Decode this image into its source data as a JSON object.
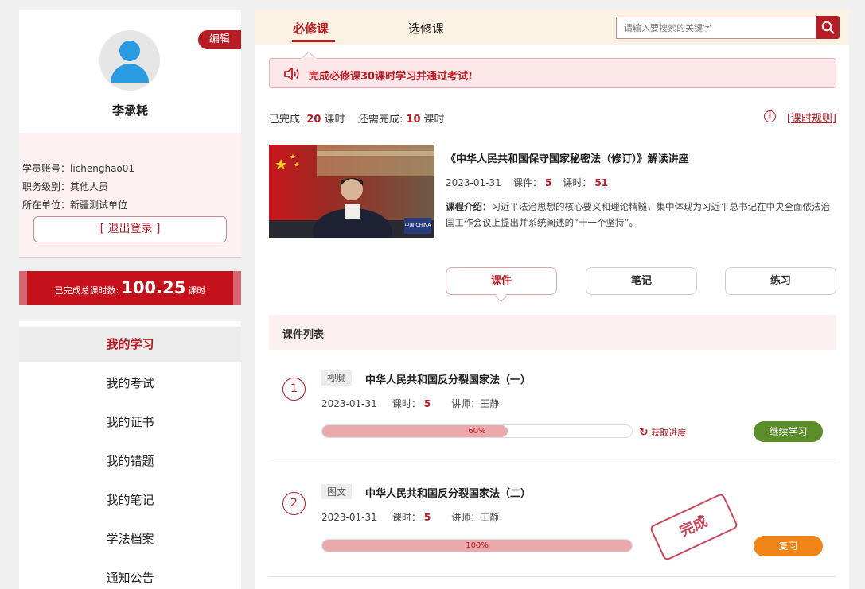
{
  "profile": {
    "edit_label": "编辑",
    "name": "李承耗",
    "account_line": "学员账号：lichenghao01",
    "level_line": "职务级别：其他人员",
    "unit_line": "所在单位：新疆测试单位",
    "logout_label": "[ 退出登录 ]"
  },
  "hours_banner": {
    "prefix": "已完成总课时数:",
    "value": "100.25",
    "suffix": "课时"
  },
  "nav": {
    "items": [
      "我的学习",
      "我的考试",
      "我的证书",
      "我的错题",
      "我的笔记",
      "学法档案",
      "通知公告"
    ],
    "active_index": 0
  },
  "tabs": {
    "required": "必修课",
    "elective": "选修课"
  },
  "search": {
    "placeholder": "请输入要搜索的关键字"
  },
  "notice": {
    "text": "完成必修课30课时学习并通过考试!"
  },
  "progress": {
    "completed_label": "已完成:",
    "completed_value": "20",
    "completed_unit": "课时",
    "remaining_label": "还需完成:",
    "remaining_value": "10",
    "remaining_unit": "课时",
    "rules_link": "[课时规则]"
  },
  "course": {
    "title": "《中华人民共和国保守国家秘密法（修订）》解读讲座",
    "date": "2023-01-31",
    "lessons_label": "课件：",
    "lessons_value": "5",
    "hours_label": "课时：",
    "hours_value": "51",
    "intro_label": "课程介绍：",
    "intro_text": "习近平法治思想的核心要义和理论精髓，集中体现为习近平总书记在中央全面依法治国工作会议上提出并系统阐述的“十一个坚持”。",
    "image_caption": "中国 CHINA"
  },
  "sub_tabs": [
    "课件",
    "笔记",
    "练习"
  ],
  "list": {
    "header": "课件列表",
    "rows": [
      {
        "index": "1",
        "type": "视频",
        "title": "中华人民共和国反分裂国家法（一）",
        "date": "2023-01-31",
        "hours_label": "课时：",
        "hours_value": "5",
        "teacher": "讲师：王静",
        "progress": 60,
        "progress_label": "60%",
        "fetch_label": "获取进度",
        "action_label": "继续学习"
      },
      {
        "index": "2",
        "type": "图文",
        "title": "中华人民共和国反分裂国家法（二）",
        "date": "2023-01-31",
        "hours_label": "课时：",
        "hours_value": "5",
        "teacher": "讲师：王静",
        "progress": 100,
        "progress_label": "100%",
        "stamp": "完成",
        "action_label": "复习"
      }
    ]
  },
  "colors": {
    "brand_red": "#b81c25",
    "continue_green": "#5b8e2b",
    "review_orange": "#ef8419"
  }
}
